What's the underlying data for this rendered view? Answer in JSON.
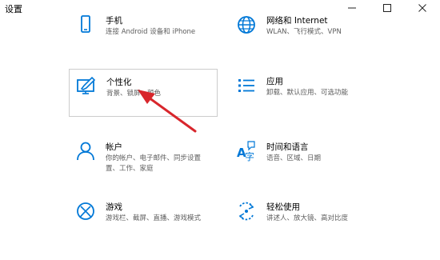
{
  "window": {
    "title": "设置",
    "controls": [
      "minimize",
      "maximize",
      "close"
    ]
  },
  "tiles": [
    {
      "name": "手机",
      "desc_lines": [
        "连接 Android 设备和 iPhone"
      ],
      "icon": "phone-icon"
    },
    {
      "name": "网络和 Internet",
      "desc_lines": [
        "WLAN、飞行模式、VPN"
      ],
      "icon": "globe-icon"
    },
    {
      "name": "个性化",
      "desc_lines": [
        "背景、锁屏、颜色"
      ],
      "icon": "personalization-icon"
    },
    {
      "name": "应用",
      "desc_lines": [
        "卸载、默认应用、可选功能"
      ],
      "icon": "apps-list-icon"
    },
    {
      "name": "帐户",
      "desc_lines": [
        "你的帐户、电子邮件、同步设置",
        "置、工作、家庭"
      ],
      "icon": "person-icon"
    },
    {
      "name": "时间和语言",
      "desc_lines": [
        "语音、区域、日期"
      ],
      "icon": "time-language-icon"
    },
    {
      "name": "游戏",
      "desc_lines": [
        "游戏栏、截屏、直播、游戏模式"
      ],
      "icon": "xbox-icon"
    },
    {
      "name": "轻松使用",
      "desc_lines": [
        "讲述人、放大镜、高对比度"
      ],
      "icon": "ease-of-access-icon"
    }
  ],
  "colors": {
    "accent": "#0078d7",
    "arrow": "#d8262c"
  }
}
